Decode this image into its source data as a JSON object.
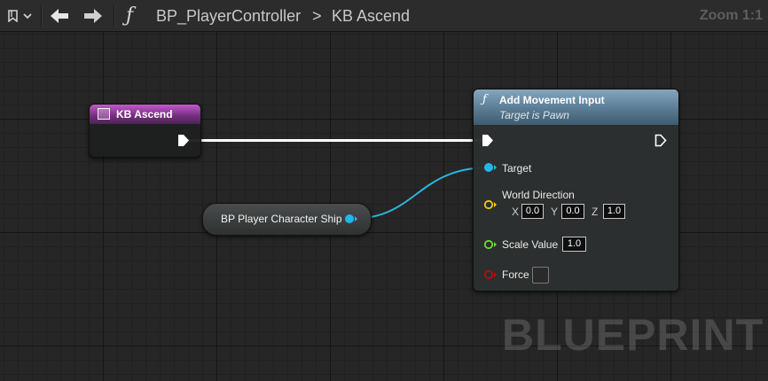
{
  "toolbar": {
    "function_symbol": "ƒ",
    "breadcrumb": {
      "graph": "BP_PlayerController",
      "separator": ">",
      "function": "KB Ascend"
    },
    "zoom": "Zoom 1:1"
  },
  "nodes": {
    "event": {
      "title": "KB Ascend",
      "header_color": "#9c48a6"
    },
    "add_movement_input": {
      "function_symbol": "ƒ",
      "title": "Add Movement Input",
      "subtitle": "Target is Pawn",
      "header_color": "#6e8ea6",
      "pins": {
        "target": "Target",
        "world_direction": "World Direction",
        "direction_axes": {
          "x": "X",
          "y": "Y",
          "z": "Z"
        },
        "direction_values": {
          "x": "0.0",
          "y": "0.0",
          "z": "1.0"
        },
        "scale_value": "Scale Value",
        "scale_value_input": "1.0",
        "force": "Force",
        "force_checked": false
      }
    },
    "variable": {
      "label": "BP Player Character Ship"
    }
  },
  "pin_colors": {
    "exec": "#ffffff",
    "object": "#20b8e8",
    "vector": "#f5c518",
    "float": "#6edc2e",
    "bool": "#b01010"
  },
  "watermark": "BLUEPRINT"
}
